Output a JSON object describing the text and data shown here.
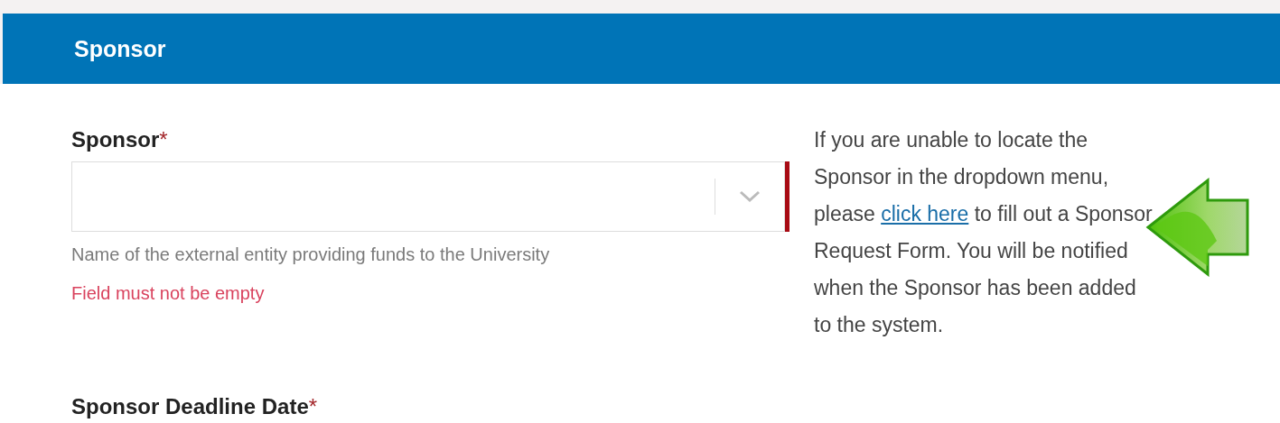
{
  "header": {
    "title": "Sponsor"
  },
  "sponsor_field": {
    "label": "Sponsor",
    "required_mark": "*",
    "invalid": true,
    "help": "Name of the external entity providing funds to the University",
    "error": "Field must not be empty"
  },
  "note": {
    "before": "If you are unable to locate the Sponsor in the dropdown menu, please ",
    "link": "click here",
    "after": " to fill out a Sponsor Request Form. You will be notified when the Sponsor has been added to the system."
  },
  "next_field": {
    "label": "Sponsor Deadline Date",
    "required_mark": "*"
  }
}
